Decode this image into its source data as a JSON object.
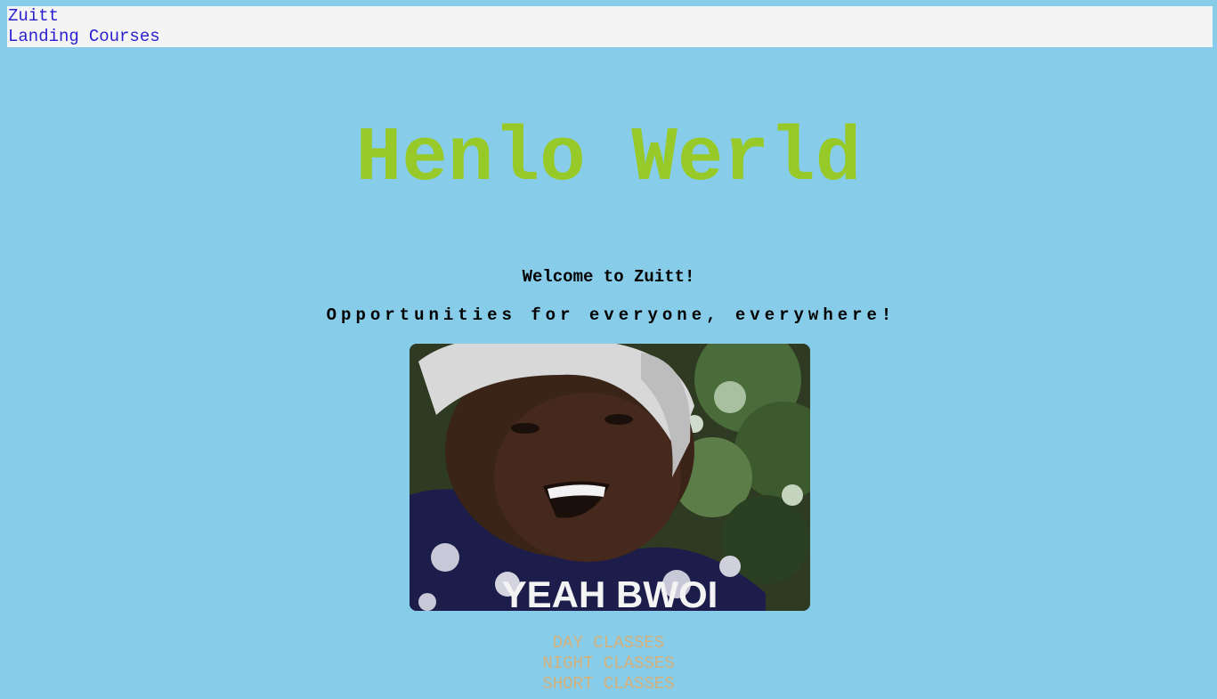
{
  "navbar": {
    "brand": "Zuitt",
    "links": [
      "Landing",
      "Courses"
    ]
  },
  "hero": {
    "title": "Henlo Werld"
  },
  "intro": {
    "welcome": "Welcome to Zuitt!",
    "tagline": "Opportunities for everyone, everywhere!"
  },
  "meme": {
    "caption": "YEAH BWOI"
  },
  "classes": [
    "DAY CLASSES",
    "NIGHT CLASSES",
    "SHORT CLASSES"
  ],
  "colors": {
    "background": "#87cdea",
    "nav_background": "#f4f4f4",
    "link": "#2a1fd0",
    "title": "#97ca28",
    "classes_text": "#d4b07a"
  }
}
